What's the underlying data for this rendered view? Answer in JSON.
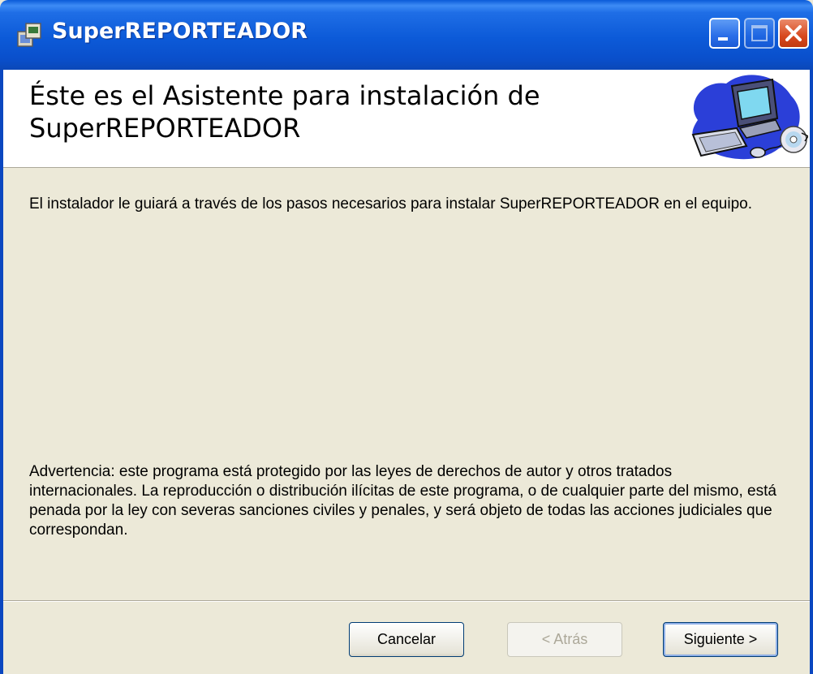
{
  "window": {
    "title": "SuperREPORTEADOR",
    "icon": "installer-icon",
    "controls": [
      "minimize-icon",
      "maximize-icon",
      "close-icon"
    ]
  },
  "header": {
    "title": "Éste es el Asistente para instalación de SuperREPORTEADOR",
    "image": "computer-cd-icon"
  },
  "content": {
    "intro": "El instalador le guiará a través de los pasos necesarios para instalar SuperREPORTEADOR en el equipo.",
    "warning": "Advertencia: este programa está protegido por las leyes de derechos de autor y otros tratados internacionales. La reproducción o distribución ilícitas de este programa, o de cualquier parte del mismo, está penada por la ley con severas sanciones civiles y penales, y será objeto de todas las acciones judiciales que correspondan."
  },
  "buttons": {
    "cancel": "Cancelar",
    "back": "< Atrás",
    "next": "Siguiente >"
  },
  "colors": {
    "titlebar": "#0c5ad8",
    "dialog_bg": "#ece9d8",
    "header_bg": "#ffffff",
    "close_button": "#d8491e"
  }
}
